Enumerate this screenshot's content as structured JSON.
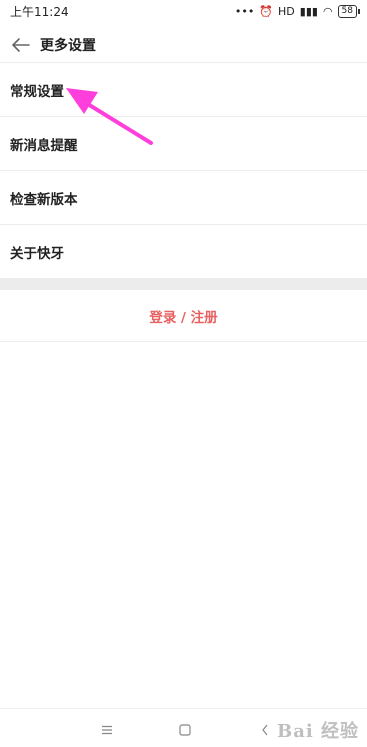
{
  "status_bar": {
    "time": "上午11:24",
    "network": "HD",
    "battery": "58"
  },
  "header": {
    "title": "更多设置"
  },
  "menu": [
    {
      "label": "常规设置"
    },
    {
      "label": "新消息提醒"
    },
    {
      "label": "检查新版本"
    },
    {
      "label": "关于快牙"
    }
  ],
  "login": {
    "label": "登录 / 注册"
  },
  "colors": {
    "accent_red": "#e86262",
    "annotation_arrow": "#ff3fdc",
    "separator": "#ececec"
  },
  "watermark": "Bai 经验"
}
